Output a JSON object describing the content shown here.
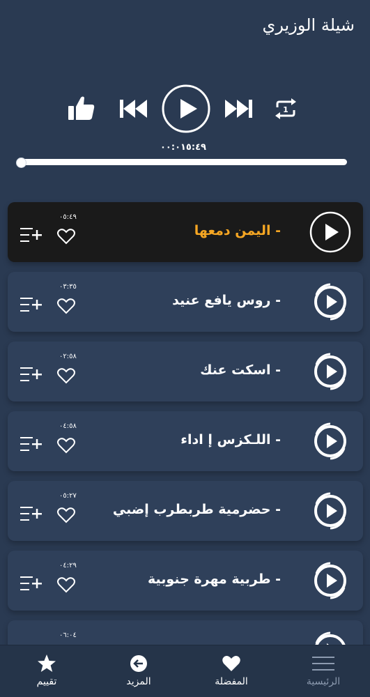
{
  "header": {
    "title": "شيلة الوزيري"
  },
  "player": {
    "time_readout": "٠٠:٠١٥:٤٩",
    "progress": 0.0
  },
  "tracks": [
    {
      "title": "-  اليمن دمعها",
      "duration": "٠٥:٤٩",
      "active": true
    },
    {
      "title": "-  روس يافع عنيد",
      "duration": "٠٣:٣٥",
      "active": false
    },
    {
      "title": "- اسكت عنك",
      "duration": "٠٢:٥٨",
      "active": false
    },
    {
      "title": "- اللـكزس إ اداء",
      "duration": "٠٤:٥٨",
      "active": false
    },
    {
      "title": "- حضرمية طربطرب إضبي",
      "duration": "٠٥:٢٧",
      "active": false
    },
    {
      "title": "- طربية  مهرة جنوبية",
      "duration": "٠٤:٢٩",
      "active": false
    },
    {
      "title": "",
      "duration": "٠٦:٠٤",
      "active": false
    }
  ],
  "bottom_nav": {
    "rate_label": "تقييم",
    "more_label": "المزيد",
    "favorites_label": "المفضلة",
    "home_label": "الرئيسية"
  },
  "colors": {
    "background": "#2a3a52",
    "card": "#2f405a",
    "active_card": "#1a1a1a",
    "active_title": "#f5a623"
  }
}
